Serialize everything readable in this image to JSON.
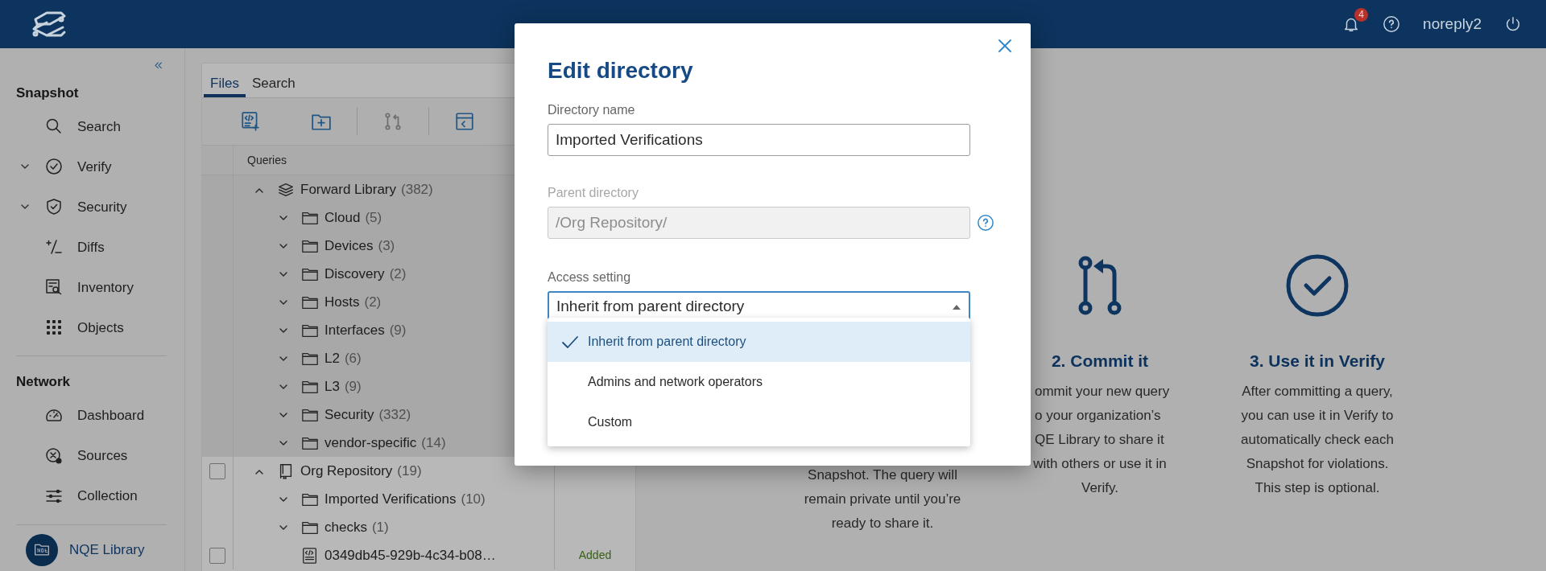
{
  "header": {
    "notifications": "4",
    "user": "noreply2"
  },
  "sidebar": {
    "sections": [
      {
        "title": "Snapshot",
        "items": [
          {
            "label": "Search",
            "selected": false
          },
          {
            "label": "Verify",
            "expanded": false,
            "selected": false
          },
          {
            "label": "Security",
            "expanded": false,
            "selected": false
          },
          {
            "label": "Diffs",
            "selected": false
          },
          {
            "label": "Inventory",
            "selected": false
          },
          {
            "label": "Objects",
            "selected": false
          }
        ]
      },
      {
        "title": "Network",
        "items": [
          {
            "label": "Dashboard",
            "selected": false
          },
          {
            "label": "Sources",
            "selected": false
          },
          {
            "label": "Collection",
            "selected": false
          }
        ]
      }
    ],
    "footer": {
      "label": "NQE Library",
      "selected": true
    }
  },
  "files_panel": {
    "tabs": [
      {
        "label": "Files",
        "selected": true
      },
      {
        "label": "Search",
        "selected": false
      }
    ],
    "toolbar": [
      {
        "disabled": false
      },
      {
        "disabled": false
      },
      {
        "disabled": true
      },
      {
        "disabled": false
      }
    ],
    "column": "Queries",
    "tree": [
      {
        "label": "Forward Library",
        "count": "(382)",
        "kind": "library",
        "expanded": true,
        "selected": true,
        "children": [
          {
            "label": "Cloud",
            "count": "(5)",
            "kind": "folder",
            "expanded": false
          },
          {
            "label": "Devices",
            "count": "(3)",
            "kind": "folder",
            "expanded": false
          },
          {
            "label": "Discovery",
            "count": "(2)",
            "kind": "folder",
            "expanded": false
          },
          {
            "label": "Hosts",
            "count": "(2)",
            "kind": "folder",
            "expanded": false
          },
          {
            "label": "Interfaces",
            "count": "(9)",
            "kind": "folder",
            "expanded": false
          },
          {
            "label": "L2",
            "count": "(6)",
            "kind": "folder",
            "expanded": false
          },
          {
            "label": "L3",
            "count": "(9)",
            "kind": "folder",
            "expanded": false
          },
          {
            "label": "Security",
            "count": "(332)",
            "kind": "folder",
            "expanded": false
          },
          {
            "label": "vendor-specific",
            "count": "(14)",
            "kind": "folder",
            "expanded": false
          }
        ]
      },
      {
        "label": "Org Repository",
        "count": "(19)",
        "kind": "repository",
        "expanded": true,
        "selected": false,
        "checked": false,
        "children": [
          {
            "label": "Imported Verifications",
            "count": "(10)",
            "kind": "folder",
            "expanded": false
          },
          {
            "label": "checks",
            "count": "(1)",
            "kind": "folder",
            "expanded": false
          },
          {
            "label": "0349db45-929b-4c34-b08…",
            "kind": "file",
            "checked": false,
            "status": "Added"
          }
        ]
      }
    ]
  },
  "steps": [
    {
      "lines": [
        {
          "text": "Snapshot. The query will",
          "clipped": false
        },
        {
          "text": "remain private until you’re",
          "clipped": false
        },
        {
          "text": "ready to share it.",
          "clipped": false
        }
      ]
    },
    {
      "kind": "commit",
      "title": "2. Commit it",
      "lines": [
        {
          "text": "ommit your new query",
          "clipped": true
        },
        {
          "text": "o your organization’s",
          "clipped": true
        },
        {
          "text": "QE Library to share it",
          "clipped": true
        },
        {
          "text": "with others or use it in",
          "clipped": false
        },
        {
          "text": "Verify.",
          "clipped": false
        }
      ]
    },
    {
      "kind": "verify",
      "title": "3. Use it in Verify",
      "lines": [
        {
          "text": "After committing a query,",
          "clipped": false
        },
        {
          "text": "you can use it in Verify to",
          "clipped": false
        },
        {
          "text": "automatically check each",
          "clipped": false
        },
        {
          "text": "Snapshot for violations.",
          "clipped": false
        },
        {
          "text": "This step is optional.",
          "clipped": false
        }
      ]
    }
  ],
  "dialog": {
    "title": "Edit directory",
    "fields": [
      {
        "label": "Directory name",
        "value": "Imported Verifications",
        "disabled": false
      },
      {
        "label": "Parent directory",
        "value": "/Org Repository/",
        "disabled": true,
        "help": true
      }
    ],
    "access": {
      "label": "Access setting",
      "value": "Inherit from parent directory",
      "expanded": true,
      "options": [
        {
          "label": "Inherit from parent directory",
          "selected": true
        },
        {
          "label": "Admins and network operators",
          "selected": false
        },
        {
          "label": "Custom",
          "selected": false
        }
      ]
    }
  }
}
